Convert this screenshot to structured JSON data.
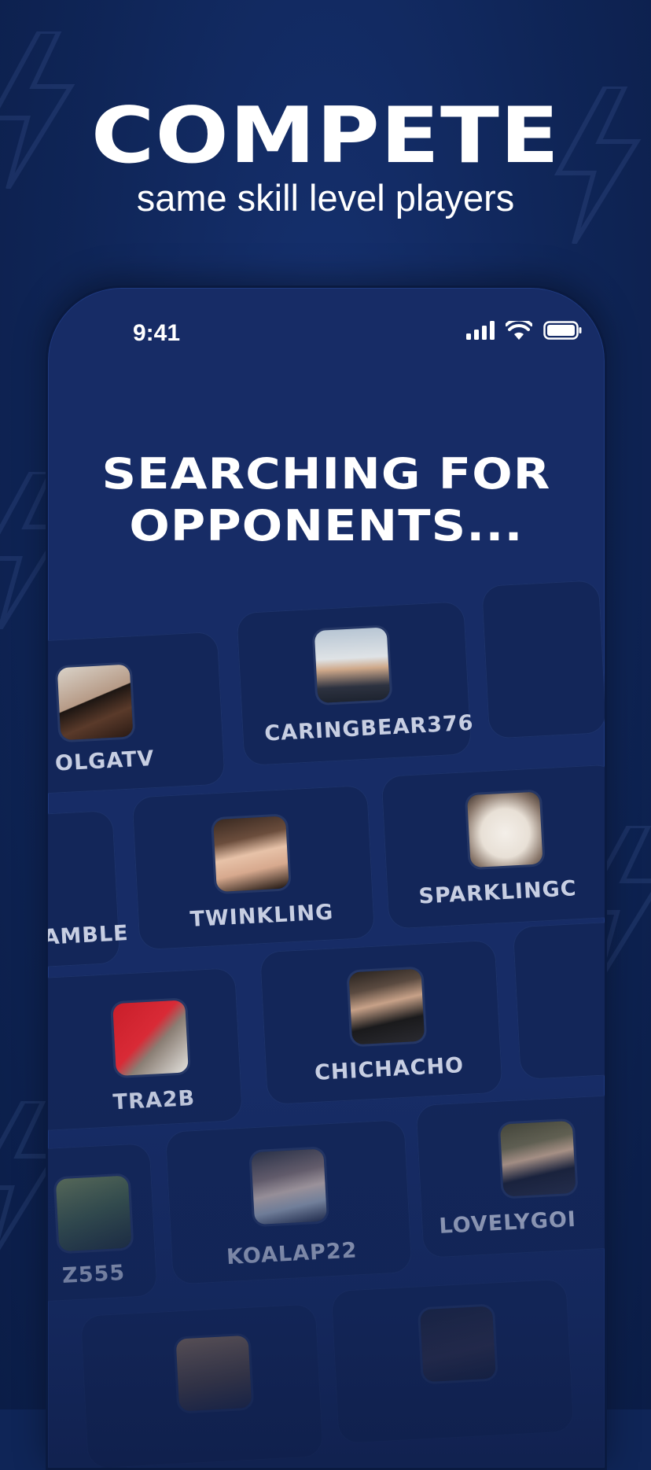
{
  "promo": {
    "headline": "COMPETE",
    "subheadline": "same skill level players"
  },
  "status_bar": {
    "time": "9:41"
  },
  "screen": {
    "title_line1": "SEARCHING FOR",
    "title_line2": "OPPONENTS..."
  },
  "players": [
    {
      "name": "OLGATV"
    },
    {
      "name": "CARINGBEAR376"
    },
    {
      "name": "AMBLE"
    },
    {
      "name": "TWINKLING"
    },
    {
      "name": "SPARKLINGC"
    },
    {
      "name": "TRA2B"
    },
    {
      "name": "CHICHACHO"
    },
    {
      "name": "Z555"
    },
    {
      "name": "KOALAP22"
    },
    {
      "name": "LOVELYGOI"
    }
  ],
  "colors": {
    "background": "#0f2557",
    "phone_screen": "#172c66",
    "card": "#132659",
    "text": "#ffffff"
  }
}
